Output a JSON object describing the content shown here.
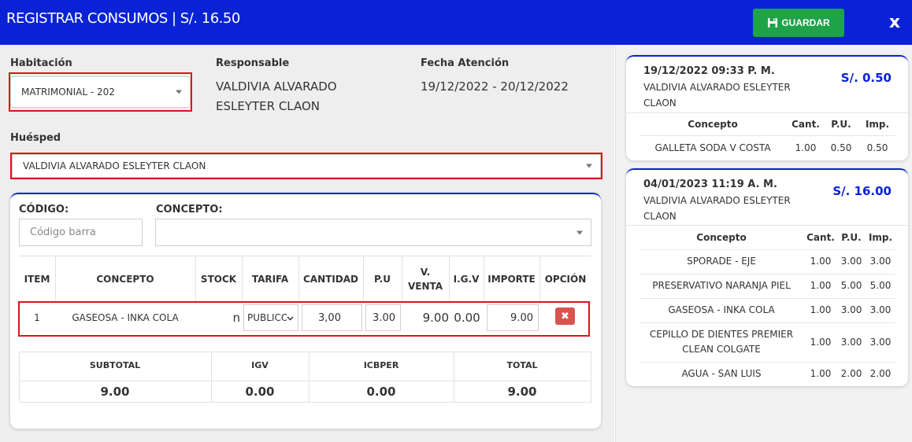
{
  "header": {
    "title": "REGISTRAR CONSUMOS | S/. 16.50",
    "save_label": "GUARDAR",
    "close_label": "x"
  },
  "form": {
    "habitacion_label": "Habitación",
    "habitacion_value": "MATRIMONIAL - 202",
    "responsable_label": "Responsable",
    "responsable_line1": "VALDIVIA ALVARADO",
    "responsable_line2": "ESLEYTER CLAON",
    "fecha_label": "Fecha Atención",
    "fecha_value": "19/12/2022 - 20/12/2022",
    "huesped_label": "Huésped",
    "huesped_value": "VALDIVIA ALVARADO ESLEYTER CLAON"
  },
  "item_entry": {
    "codigo_label": "CÓDIGO:",
    "codigo_placeholder": "Código barra",
    "concepto_label": "CONCEPTO:",
    "concepto_value": ""
  },
  "items_table": {
    "headers": {
      "item": "ITEM",
      "concepto": "CONCEPTO",
      "stock": "STOCK",
      "tarifa": "TARIFA",
      "cantidad": "CANTIDAD",
      "pu": "P.U",
      "vventa_1": "V.",
      "vventa_2": "VENTA",
      "igv": "I.G.V",
      "importe": "IMPORTE",
      "opcion": "OPCIÓN"
    },
    "rows": [
      {
        "item": "1",
        "concepto": "GASEOSA - INKA COLA",
        "stock": "n",
        "tarifa": "PUBLICO",
        "cantidad": "3,00",
        "pu": "3.00",
        "vventa": "9.00",
        "igv": "0.00",
        "importe": "9.00",
        "delete_icon": "✖"
      }
    ]
  },
  "totals": {
    "subtotal_label": "SUBTOTAL",
    "igv_label": "IGV",
    "icbper_label": "ICBPER",
    "total_label": "TOTAL",
    "subtotal": "9.00",
    "igv": "0.00",
    "icbper": "0.00",
    "total": "9.00"
  },
  "history": {
    "col_concepto": "Concepto",
    "col_cant": "Cant.",
    "col_pu": "P.U.",
    "col_imp": "Imp.",
    "cards": [
      {
        "date": "19/12/2022 09:33 P. M.",
        "name_line1": "VALDIVIA ALVARADO ESLEYTER",
        "name_line2": "CLAON",
        "amount": "S/. 0.50",
        "rows": [
          {
            "concepto": "GALLETA SODA V COSTA",
            "cant": "1.00",
            "pu": "0.50",
            "imp": "0.50"
          }
        ]
      },
      {
        "date": "04/01/2023 11:19 A. M.",
        "name_line1": "VALDIVIA ALVARADO ESLEYTER",
        "name_line2": "CLAON",
        "amount": "S/. 16.00",
        "rows": [
          {
            "concepto": "SPORADE - EJE",
            "cant": "1.00",
            "pu": "3.00",
            "imp": "3.00"
          },
          {
            "concepto": "PRESERVATIVO NARANJA PIEL",
            "cant": "1.00",
            "pu": "5.00",
            "imp": "5.00"
          },
          {
            "concepto": "GASEOSA - INKA COLA",
            "cant": "1.00",
            "pu": "3.00",
            "imp": "3.00"
          },
          {
            "concepto_line1": "CEPILLO DE DIENTES PREMIER",
            "concepto_line2": "CLEAN COLGATE",
            "cant": "1.00",
            "pu": "3.00",
            "imp": "3.00"
          },
          {
            "concepto": "AGUA - SAN LUIS",
            "cant": "1.00",
            "pu": "2.00",
            "imp": "2.00"
          }
        ]
      }
    ]
  },
  "colors": {
    "header_blue": "#0a22d6",
    "save_green": "#1ea34a",
    "highlight_red": "#e0101a",
    "delete_red": "#d9534f"
  }
}
